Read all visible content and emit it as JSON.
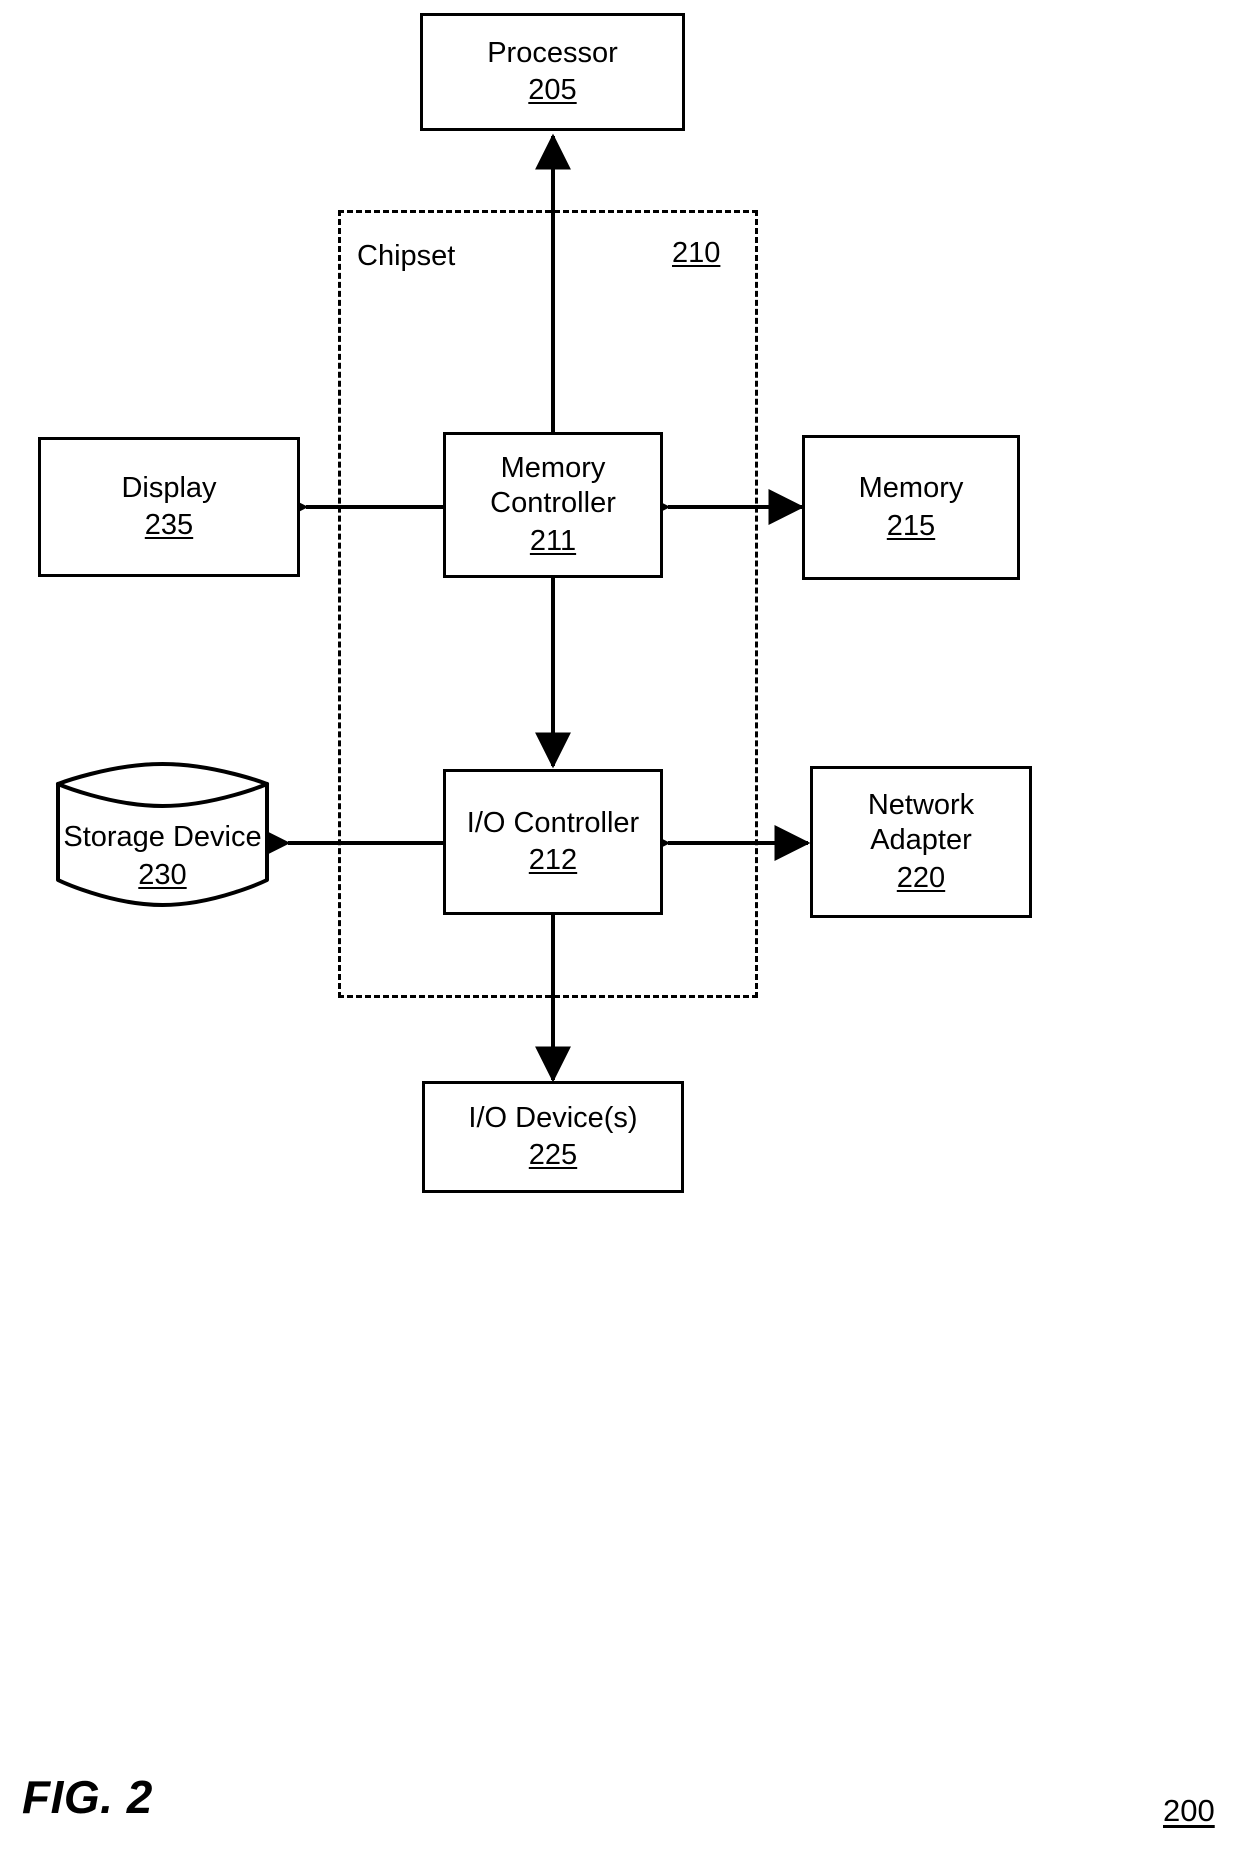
{
  "figure": {
    "caption": "FIG. 2",
    "reference_numeral": "200"
  },
  "chipset": {
    "label": "Chipset",
    "reference_numeral": "210"
  },
  "nodes": {
    "processor": {
      "label": "Processor",
      "reference_numeral": "205"
    },
    "memory_controller": {
      "label": "Memory\nController",
      "reference_numeral": "211"
    },
    "memory": {
      "label": "Memory",
      "reference_numeral": "215"
    },
    "display": {
      "label": "Display",
      "reference_numeral": "235"
    },
    "io_controller": {
      "label": "I/O Controller",
      "reference_numeral": "212"
    },
    "network_adapter": {
      "label": "Network\nAdapter",
      "reference_numeral": "220"
    },
    "storage_device": {
      "label": "Storage Device",
      "reference_numeral": "230"
    },
    "io_devices": {
      "label": "I/O Device(s)",
      "reference_numeral": "225"
    }
  },
  "connections": [
    {
      "name": "processor-to-memory-controller",
      "from": "memory_controller",
      "to": "processor",
      "arrows": "both",
      "orientation": "vertical"
    },
    {
      "name": "display-to-memory-controller",
      "from": "display",
      "to": "memory_controller",
      "arrows": "both",
      "orientation": "horizontal"
    },
    {
      "name": "memory-controller-to-memory",
      "from": "memory_controller",
      "to": "memory",
      "arrows": "both",
      "orientation": "horizontal"
    },
    {
      "name": "memory-controller-to-io-controller",
      "from": "memory_controller",
      "to": "io_controller",
      "arrows": "both",
      "orientation": "vertical"
    },
    {
      "name": "storage-device-to-io-controller",
      "from": "storage_device",
      "to": "io_controller",
      "arrows": "both",
      "orientation": "horizontal"
    },
    {
      "name": "io-controller-to-network-adapter",
      "from": "io_controller",
      "to": "network_adapter",
      "arrows": "both",
      "orientation": "horizontal"
    },
    {
      "name": "io-controller-to-io-devices",
      "from": "io_controller",
      "to": "io_devices",
      "arrows": "both",
      "orientation": "vertical"
    }
  ],
  "style": {
    "stroke_color": "#000000",
    "background_color": "#ffffff"
  }
}
